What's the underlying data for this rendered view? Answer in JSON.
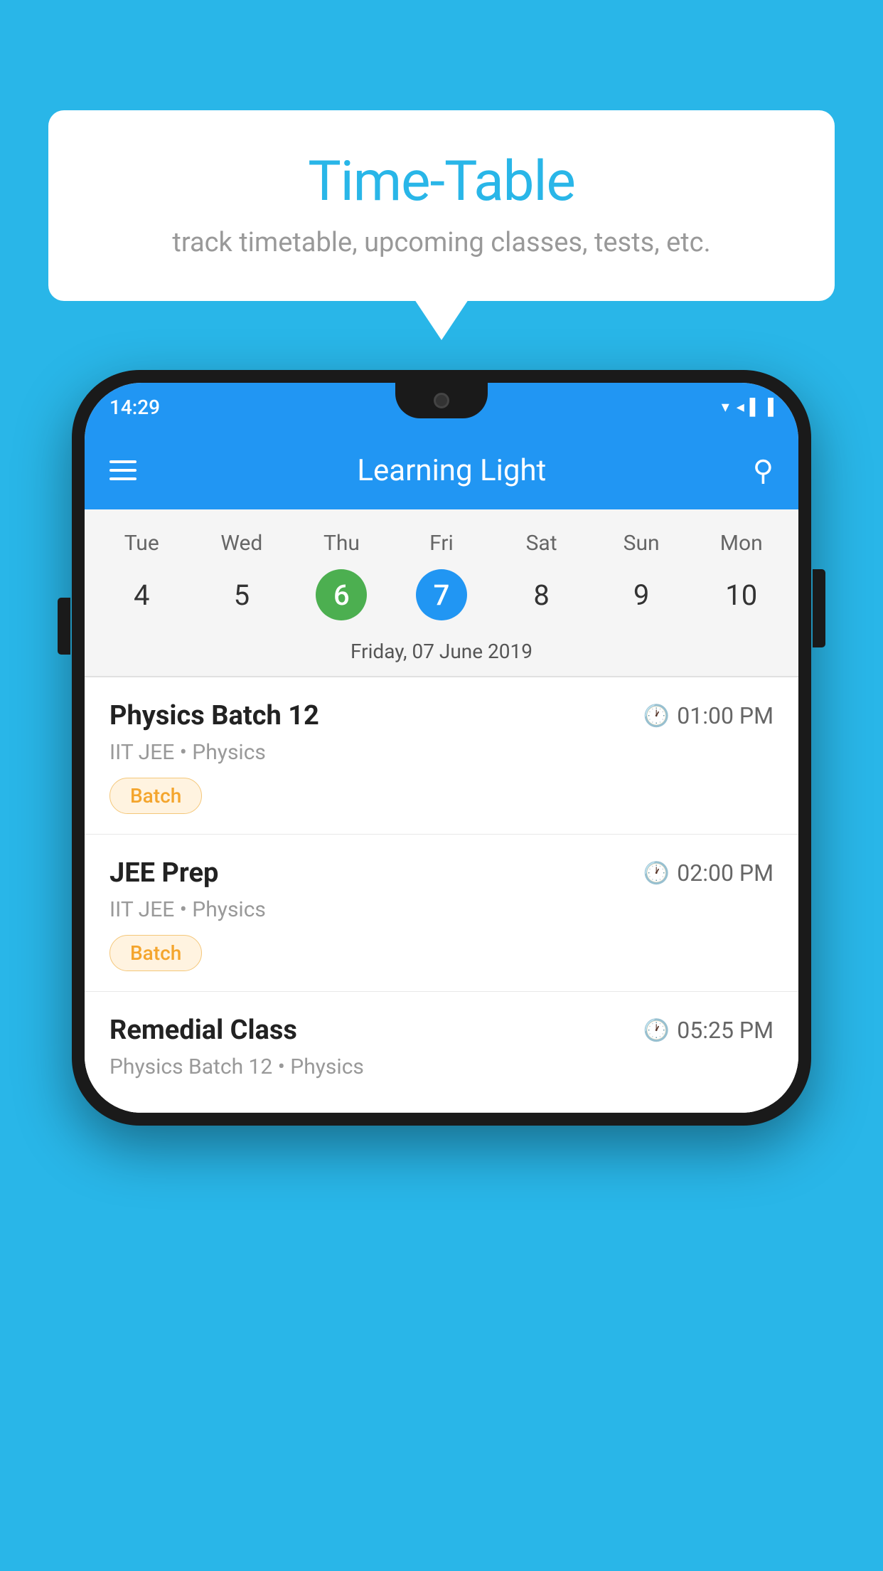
{
  "page": {
    "background_color": "#29b6e8"
  },
  "speech_bubble": {
    "title": "Time-Table",
    "subtitle": "track timetable, upcoming classes, tests, etc."
  },
  "status_bar": {
    "time": "14:29",
    "icons": "▾◂▐"
  },
  "app_bar": {
    "title": "Learning Light",
    "menu_icon": "menu",
    "search_icon": "search"
  },
  "calendar": {
    "day_headers": [
      "Tue",
      "Wed",
      "Thu",
      "Fri",
      "Sat",
      "Sun",
      "Mon"
    ],
    "day_numbers": [
      "4",
      "5",
      "6",
      "7",
      "8",
      "9",
      "10"
    ],
    "today_index": 2,
    "selected_index": 3,
    "selected_date_label": "Friday, 07 June 2019"
  },
  "schedule_items": [
    {
      "title": "Physics Batch 12",
      "time": "01:00 PM",
      "subtitle": "IIT JEE • Physics",
      "badge": "Batch"
    },
    {
      "title": "JEE Prep",
      "time": "02:00 PM",
      "subtitle": "IIT JEE • Physics",
      "badge": "Batch"
    },
    {
      "title": "Remedial Class",
      "time": "05:25 PM",
      "subtitle": "Physics Batch 12 • Physics",
      "badge": null
    }
  ]
}
